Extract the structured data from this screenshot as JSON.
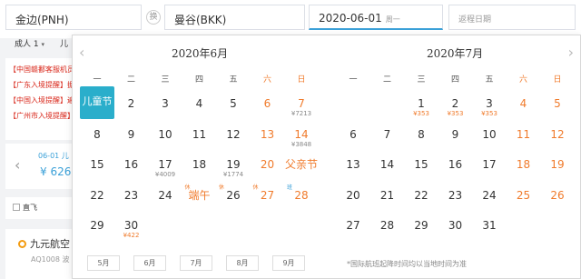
{
  "search": {
    "from": "金边(PNH)",
    "swap_label": "换",
    "to": "曼谷(BKK)",
    "depart_date": "2020-06-01",
    "depart_weekday": "周一",
    "return_placeholder": "返程日期",
    "passengers": "成人 1",
    "passengers_more": "儿"
  },
  "notices": [
    "【中国赣鄱客服机员",
    "【广东入境提醒】据",
    "【中国入境提醒】遍",
    "【广州市入境提醒】"
  ],
  "date_strip": {
    "date": "06-01 儿",
    "price": "¥ 626"
  },
  "filter": {
    "direct_label": "直飞"
  },
  "flight": {
    "airline": "九元航空",
    "code": "AQ1008 波"
  },
  "calendar": {
    "weekdays": [
      "一",
      "二",
      "三",
      "四",
      "五",
      "六",
      "日"
    ],
    "june": {
      "title": "2020年6月",
      "weeks": [
        [
          {
            "d": "儿童节",
            "sel": true
          },
          {
            "d": "2"
          },
          {
            "d": "3"
          },
          {
            "d": "4"
          },
          {
            "d": "5"
          },
          {
            "d": "6"
          },
          {
            "d": "7",
            "p": "¥7213"
          }
        ],
        [
          {
            "d": "8"
          },
          {
            "d": "9"
          },
          {
            "d": "10"
          },
          {
            "d": "11"
          },
          {
            "d": "12"
          },
          {
            "d": "13"
          },
          {
            "d": "14",
            "p": "¥3848"
          }
        ],
        [
          {
            "d": "15"
          },
          {
            "d": "16"
          },
          {
            "d": "17",
            "p": "¥4009"
          },
          {
            "d": "18"
          },
          {
            "d": "19",
            "p": "¥1774"
          },
          {
            "d": "20"
          },
          {
            "d": "父亲节",
            "fest": true
          }
        ],
        [
          {
            "d": "22"
          },
          {
            "d": "23"
          },
          {
            "d": "24"
          },
          {
            "d": "端午",
            "fest": true,
            "tag": "休",
            "tt": "rest"
          },
          {
            "d": "26",
            "tag": "休",
            "tt": "rest"
          },
          {
            "d": "27",
            "tag": "休",
            "tt": "rest"
          },
          {
            "d": "28",
            "tag": "班",
            "tt": "work"
          }
        ],
        [
          {
            "d": "29"
          },
          {
            "d": "30",
            "p": "¥422",
            "pr": true
          }
        ]
      ]
    },
    "july": {
      "title": "2020年7月",
      "weeks": [
        [
          {
            "d": ""
          },
          {
            "d": ""
          },
          {
            "d": "1",
            "p": "¥353",
            "pr": true
          },
          {
            "d": "2",
            "p": "¥353",
            "pr": true
          },
          {
            "d": "3",
            "p": "¥353",
            "pr": true
          },
          {
            "d": "4"
          },
          {
            "d": "5"
          }
        ],
        [
          {
            "d": "6"
          },
          {
            "d": "7"
          },
          {
            "d": "8"
          },
          {
            "d": "9"
          },
          {
            "d": "10"
          },
          {
            "d": "11"
          },
          {
            "d": "12"
          }
        ],
        [
          {
            "d": "13"
          },
          {
            "d": "14"
          },
          {
            "d": "15"
          },
          {
            "d": "16"
          },
          {
            "d": "17"
          },
          {
            "d": "18"
          },
          {
            "d": "19"
          }
        ],
        [
          {
            "d": "20"
          },
          {
            "d": "21"
          },
          {
            "d": "22"
          },
          {
            "d": "23"
          },
          {
            "d": "24"
          },
          {
            "d": "25"
          },
          {
            "d": "26"
          }
        ],
        [
          {
            "d": "27"
          },
          {
            "d": "28"
          },
          {
            "d": "29"
          },
          {
            "d": "30"
          },
          {
            "d": "31"
          }
        ]
      ]
    },
    "month_buttons": [
      "5月",
      "6月",
      "7月",
      "8月",
      "9月"
    ],
    "note": "*国际航班起降时间均以当地时间为准"
  }
}
